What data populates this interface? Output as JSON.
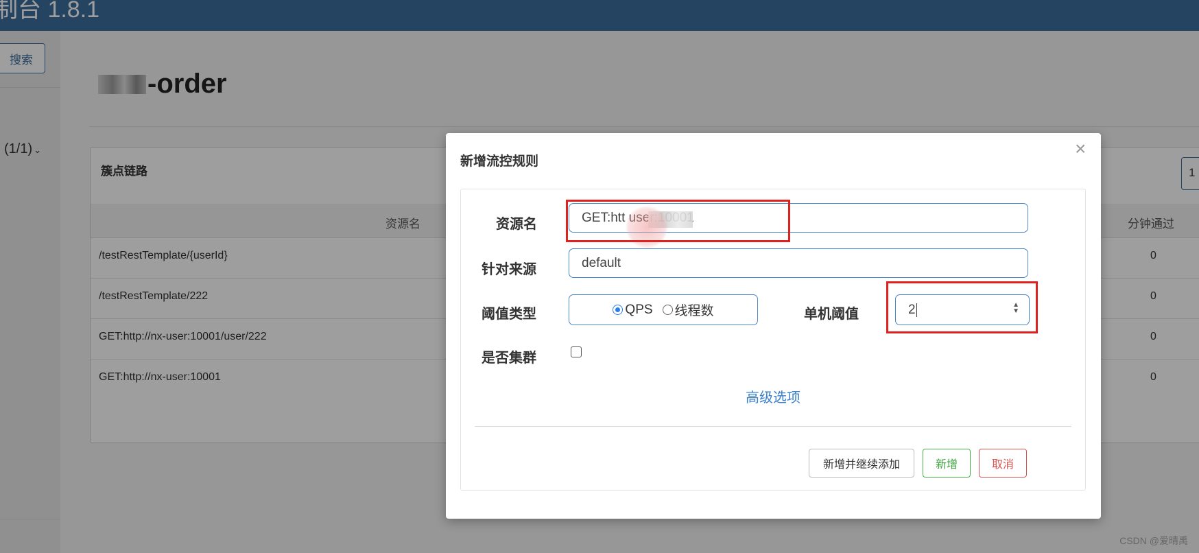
{
  "app": {
    "title": "制台 1.8.1"
  },
  "sidebar": {
    "search_label": "搜索",
    "app_selector": "(1/1)"
  },
  "page": {
    "title": "-order"
  },
  "panel": {
    "title": "簇点链路",
    "page_size": "1",
    "columns": {
      "resource": "资源名",
      "minute_pass": "分钟通过"
    },
    "rows": [
      {
        "resource": "/testRestTemplate/{userId}",
        "minute_pass": "0"
      },
      {
        "resource": "/testRestTemplate/222",
        "minute_pass": "0"
      },
      {
        "resource": "GET:http://nx-user:10001/user/222",
        "minute_pass": "0"
      },
      {
        "resource": "GET:http://nx-user:10001",
        "minute_pass": "0"
      }
    ]
  },
  "modal": {
    "title": "新增流控规则",
    "close": "×",
    "resource_label": "资源名",
    "resource_value": "GET:htt      user:10001",
    "origin_label": "针对来源",
    "origin_value": "default",
    "threshold_type_label": "阈值类型",
    "threshold_options": {
      "qps": "QPS",
      "threads": "线程数"
    },
    "selected_threshold_type": "QPS",
    "single_threshold_label": "单机阈值",
    "single_threshold_value": "2",
    "cluster_label": "是否集群",
    "cluster_checked": false,
    "advanced_label": "高级选项",
    "buttons": {
      "add_continue": "新增并继续添加",
      "add": "新增",
      "cancel": "取消"
    }
  },
  "watermark": "CSDN @爱晴禹",
  "colors": {
    "header": "#3c6e9f",
    "highlight": "#e0221f",
    "link": "#3a7fcb"
  }
}
